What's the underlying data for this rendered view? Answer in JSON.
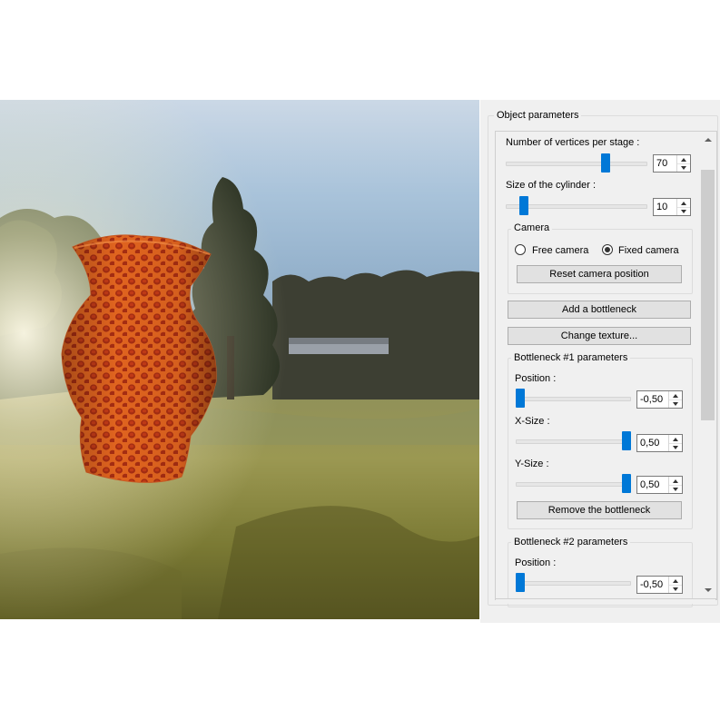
{
  "panel": {
    "group_title": "Object parameters",
    "vertices": {
      "label": "Number of vertices per stage :",
      "value": "70",
      "level": 0.72
    },
    "cylinder": {
      "label": "Size of the cylinder :",
      "value": "10",
      "level": 0.1
    },
    "camera": {
      "title": "Camera",
      "free_label": "Free camera",
      "fixed_label": "Fixed camera",
      "selected": "fixed",
      "reset_label": "Reset camera position"
    },
    "add_bottleneck_label": "Add a bottleneck",
    "change_texture_label": "Change texture...",
    "bottleneck1": {
      "title": "Bottleneck #1 parameters",
      "position": {
        "label": "Position :",
        "value": "-0,50",
        "level": 0.0
      },
      "xsize": {
        "label": "X-Size :",
        "value": "0,50",
        "level": 1.0
      },
      "ysize": {
        "label": "Y-Size :",
        "value": "0,50",
        "level": 1.0
      },
      "remove_label": "Remove the bottleneck"
    },
    "bottleneck2": {
      "title": "Bottleneck #2 parameters",
      "position": {
        "label": "Position :",
        "value": "-0,50",
        "level": 0.0
      }
    }
  },
  "colors": {
    "accent": "#0078d7",
    "vase": "#d8561e",
    "panel_bg": "#f0f0f0"
  }
}
